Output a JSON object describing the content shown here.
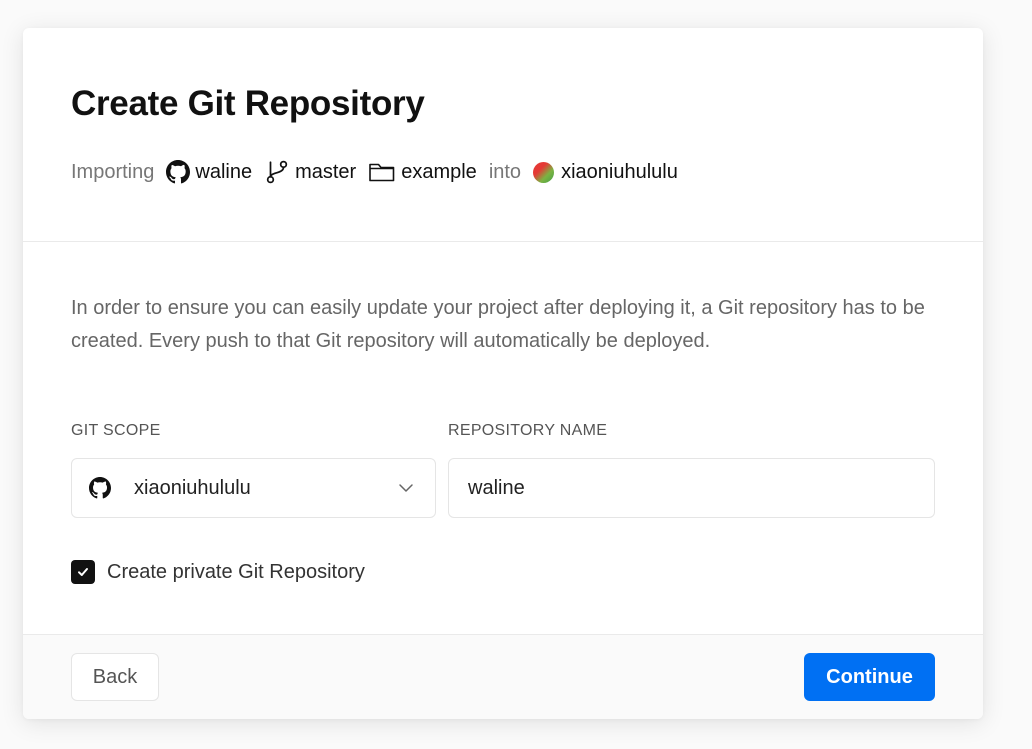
{
  "dialog": {
    "title": "Create Git Repository",
    "import_line": {
      "prefix": "Importing",
      "repo": "waline",
      "branch": "master",
      "folder": "example",
      "connector": "into",
      "team": "xiaoniuhululu"
    },
    "description": "In order to ensure you can easily update your project after deploying it, a Git repository has to be created. Every push to that Git repository will automatically be deployed.",
    "git_scope": {
      "label": "GIT SCOPE",
      "value": "xiaoniuhululu",
      "icon": "github-icon"
    },
    "repository_name": {
      "label": "REPOSITORY NAME",
      "value": "waline"
    },
    "private_checkbox": {
      "label": "Create private Git Repository",
      "checked": true
    },
    "footer": {
      "back_label": "Back",
      "continue_label": "Continue"
    },
    "colors": {
      "primary": "#0070f3",
      "checkbox": "#111111"
    }
  }
}
